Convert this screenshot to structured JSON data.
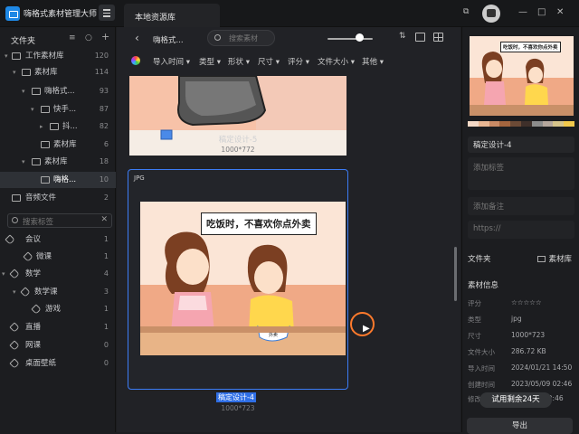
{
  "app": {
    "title": "嗨格式素材管理大师"
  },
  "tabs": [
    {
      "label": "本地资源库"
    }
  ],
  "sidebar": {
    "header": "文件夹",
    "tree": [
      {
        "label": "工作素材库",
        "count": "120"
      },
      {
        "label": "素材库",
        "count": "114"
      },
      {
        "label": "嗨格式...",
        "count": "93"
      },
      {
        "label": "快手...",
        "count": "87"
      },
      {
        "label": "抖...",
        "count": "82"
      },
      {
        "label": "素材库",
        "count": "6"
      },
      {
        "label": "素材库",
        "count": "18"
      },
      {
        "label": "嗨格...",
        "count": "10"
      },
      {
        "label": "音频文件",
        "count": "2"
      }
    ],
    "tag_search_placeholder": "搜索标签",
    "tags": [
      {
        "label": "会议",
        "count": "1"
      },
      {
        "label": "微课",
        "count": "1"
      },
      {
        "label": "数学",
        "count": "4"
      },
      {
        "label": "数学课",
        "count": "3"
      },
      {
        "label": "游戏",
        "count": "1"
      },
      {
        "label": "直播",
        "count": "1"
      },
      {
        "label": "网课",
        "count": "0"
      },
      {
        "label": "桌面壁纸",
        "count": "0"
      }
    ]
  },
  "main": {
    "breadcrumb": "嗨格式...",
    "search_placeholder": "搜索素材",
    "zoom_fraction": 0.7,
    "filters": [
      "导入时间",
      "类型",
      "形状",
      "尺寸",
      "评分",
      "文件大小",
      "其他"
    ],
    "items": [
      {
        "name": "稿定设计-5",
        "dims": "1000*772"
      },
      {
        "name": "稿定设计-4",
        "dims": "1000*723",
        "format": "JPG",
        "caption": "吃饭时，不喜欢你点外卖",
        "bowl_text": "外卖"
      }
    ]
  },
  "inspector": {
    "preview_caption": "吃饭时，不喜欢你点外卖",
    "swatches": [
      "#f4d9c6",
      "#e9b793",
      "#c98a65",
      "#a4653e",
      "#6b4a36",
      "#3e2f2a",
      "#8c8c8c",
      "#b5a79d",
      "#d6c48b",
      "#f2c94c"
    ],
    "name": "稿定设计-4",
    "tags_placeholder": "添加标签",
    "notes_placeholder": "添加备注",
    "url_placeholder": "https://",
    "folder_label": "文件夹",
    "folder_value": "素材库",
    "info_label": "素材信息",
    "info": [
      {
        "k": "评分",
        "v": "☆☆☆☆☆"
      },
      {
        "k": "类型",
        "v": "jpg"
      },
      {
        "k": "尺寸",
        "v": "1000*723"
      },
      {
        "k": "文件大小",
        "v": "286.72 KB"
      },
      {
        "k": "导入时间",
        "v": "2024/01/21 14:50"
      },
      {
        "k": "创建时间",
        "v": "2023/05/09 02:46"
      },
      {
        "k": "修改时间",
        "v": "02:46"
      }
    ],
    "trial": "试用剩余24天",
    "export": "导出"
  }
}
